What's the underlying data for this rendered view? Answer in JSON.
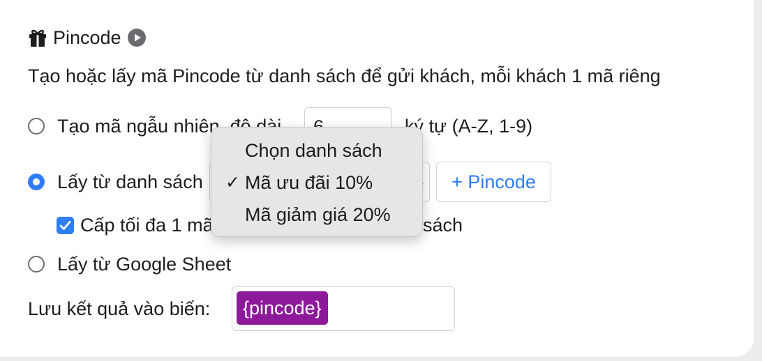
{
  "header": {
    "title": "Pincode",
    "description": "Tạo hoặc lấy mã Pincode từ danh sách để gửi khách, mỗi khách 1 mã riêng"
  },
  "options": {
    "random": {
      "label_before": "Tạo mã ngẫu nhiên, độ dài",
      "length_value": "6",
      "label_after": "ký tự (A-Z, 1-9)",
      "selected": false
    },
    "from_list": {
      "label": "Lấy từ danh sách",
      "selected": true,
      "add_button_label": "+ Pincode",
      "limit_checkbox_label_start": "Cấp tối đa 1 mã",
      "limit_checkbox_label_end": "sách",
      "limit_checked": true
    },
    "google_sheet": {
      "label": "Lấy từ Google Sheet",
      "selected": false
    }
  },
  "save_variable": {
    "label": "Lưu kết quả vào biến:",
    "token": "{pincode}"
  },
  "dropdown": {
    "items": [
      {
        "label": "Chọn danh sách",
        "checked": false
      },
      {
        "label": "Mã ưu đãi 10%",
        "checked": true
      },
      {
        "label": "Mã giảm giá 20%",
        "checked": false
      }
    ],
    "check_glyph": "✓"
  },
  "colors": {
    "accent": "#2e7cf6",
    "token_bg": "#8c1a9b"
  }
}
